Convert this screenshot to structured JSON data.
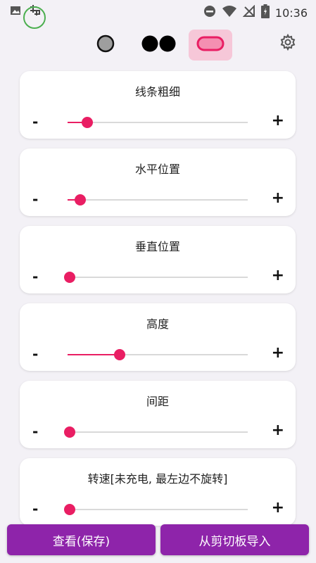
{
  "status": {
    "time": "10:36"
  },
  "settings": [
    {
      "title": "线条粗细",
      "value": 0.11,
      "minus": "-",
      "plus": "+"
    },
    {
      "title": "水平位置",
      "value": 0.07,
      "minus": "-",
      "plus": "+"
    },
    {
      "title": "垂直位置",
      "value": 0.01,
      "minus": "-",
      "plus": "+"
    },
    {
      "title": "高度",
      "value": 0.29,
      "minus": "-",
      "plus": "+"
    },
    {
      "title": "间距",
      "value": 0.01,
      "minus": "-",
      "plus": "+"
    },
    {
      "title": "转速[未充电, 最左边不旋转]",
      "value": 0.0,
      "minus": "-",
      "plus": "+"
    }
  ],
  "buttons": {
    "view_save": "查看(保存)",
    "import_clipboard": "从剪切板导入"
  },
  "colors": {
    "accent": "#e91e63",
    "button": "#8e24aa",
    "selected_mode_bg": "#f6c7d8"
  },
  "icons": [
    "image-icon",
    "app-notification-icon",
    "do-not-disturb-icon",
    "wifi-icon",
    "no-signal-icon",
    "battery-icon",
    "single-circle-mode-icon",
    "double-circle-mode-icon",
    "pill-mode-icon",
    "gear-icon"
  ]
}
